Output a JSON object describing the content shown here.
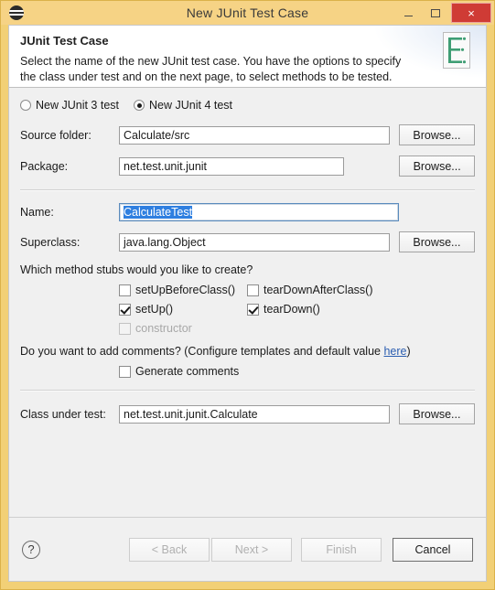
{
  "window": {
    "title": "New JUnit Test Case",
    "app_icon": "eclipse-icon",
    "minimize_label": "Minimize",
    "maximize_label": "Maximize",
    "close_label": "×",
    "frame_color": "#f2d076",
    "titlebar_color": "#f6d385",
    "close_color": "#cf3b35"
  },
  "banner": {
    "title": "JUnit Test Case",
    "description": "Select the name of the new JUnit test case. You have the options to specify the class under test and on the next page, to select methods to be tested.",
    "icon": "junit-test-case-icon"
  },
  "version_radios": [
    {
      "label": "New JUnit 3 test",
      "selected": false
    },
    {
      "label": "New JUnit 4 test",
      "selected": true
    }
  ],
  "fields": {
    "source_folder": {
      "label": "Source folder:",
      "value": "Calculate/src",
      "browse_label": "Browse...",
      "focused": false
    },
    "package": {
      "label": "Package:",
      "value": "net.test.unit.junit",
      "browse_label": "Browse...",
      "focused": false
    },
    "name": {
      "label": "Name:",
      "value": "CalculateTest",
      "focused": true,
      "selected_text": "CalculateTest"
    },
    "superclass": {
      "label": "Superclass:",
      "value": "java.lang.Object",
      "browse_label": "Browse...",
      "focused": false
    },
    "class_under_test": {
      "label": "Class under test:",
      "value": "net.test.unit.junit.Calculate",
      "browse_label": "Browse...",
      "focused": false
    }
  },
  "method_stubs": {
    "question": "Which method stubs would you like to create?",
    "items": [
      {
        "label": "setUpBeforeClass()",
        "checked": false,
        "disabled": false
      },
      {
        "label": "tearDownAfterClass()",
        "checked": false,
        "disabled": false
      },
      {
        "label": "setUp()",
        "checked": true,
        "disabled": false
      },
      {
        "label": "tearDown()",
        "checked": true,
        "disabled": false
      },
      {
        "label": "constructor",
        "checked": false,
        "disabled": true
      }
    ]
  },
  "comments": {
    "question_prefix": "Do you want to add comments? (Configure templates and default value ",
    "link_label": "here",
    "question_suffix": ")",
    "checkbox": {
      "label": "Generate comments",
      "checked": false
    }
  },
  "buttons": {
    "help": "?",
    "back": {
      "label": "< Back",
      "enabled": false
    },
    "next": {
      "label": "Next >",
      "enabled": false
    },
    "finish": {
      "label": "Finish",
      "enabled": false
    },
    "cancel": {
      "label": "Cancel",
      "enabled": true
    }
  }
}
